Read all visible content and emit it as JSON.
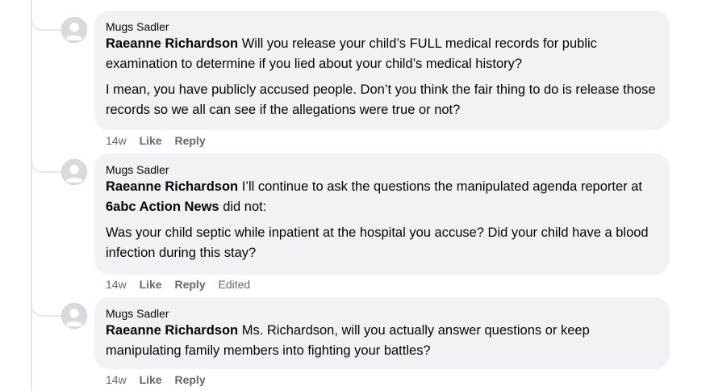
{
  "comments": [
    {
      "author": "Mugs Sadler",
      "mention": "Raeanne Richardson",
      "text1": " Will you release your child’s FULL medical records for public examination to determine if you lied about your child’s medical history?",
      "text2": "I mean, you have publicly accused people. Don’t you think the fair thing to do is release those records so we all can see if the allegations were true or not?",
      "time": "14w",
      "like": "Like",
      "reply": "Reply"
    },
    {
      "author": "Mugs Sadler",
      "mention": "Raeanne Richardson",
      "text1a": " I’ll continue to ask the questions the manipulated agenda reporter at ",
      "page_mention": "6abc Action News",
      "text1b": " did not:",
      "text2": "Was your child septic while inpatient at the hospital you accuse? Did your child have a blood infection during this stay?",
      "time": "14w",
      "like": "Like",
      "reply": "Reply",
      "edited": "Edited"
    },
    {
      "author": "Mugs Sadler",
      "mention": "Raeanne Richardson",
      "text1": " Ms. Richardson, will you actually answer questions or keep manipulating family members into fighting your battles?",
      "time": "14w",
      "like": "Like",
      "reply": "Reply"
    }
  ],
  "colors": {
    "bubble": "#f0f2f5",
    "meta": "#65676b",
    "text": "#050505",
    "thread_line": "#e4e6eb"
  },
  "icons": {
    "avatar": "default-profile-silhouette-icon"
  }
}
